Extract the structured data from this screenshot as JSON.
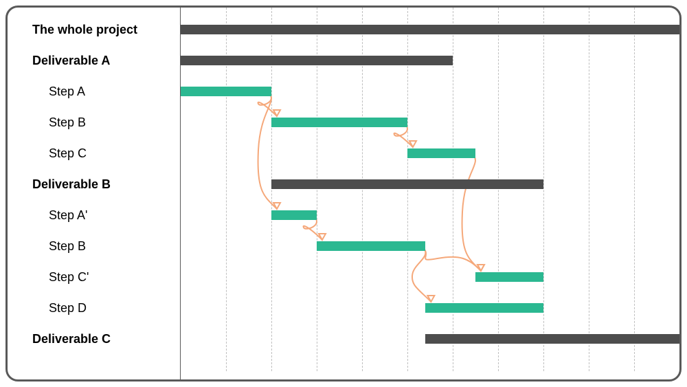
{
  "chart_data": {
    "type": "bar",
    "title": "",
    "xlabel": "",
    "ylabel": "",
    "x_range": [
      0,
      11
    ],
    "grid_lines": [
      1,
      2,
      3,
      4,
      5,
      6,
      7,
      8,
      9,
      10
    ],
    "rows": [
      {
        "id": "whole",
        "label": "The whole project",
        "kind": "summary",
        "start": 0,
        "end": 11
      },
      {
        "id": "delA",
        "label": "Deliverable A",
        "kind": "summary",
        "start": 0,
        "end": 6
      },
      {
        "id": "stepA",
        "label": "Step A",
        "kind": "task",
        "start": 0,
        "end": 2
      },
      {
        "id": "stepB",
        "label": "Step B",
        "kind": "task",
        "start": 2,
        "end": 5
      },
      {
        "id": "stepC",
        "label": "Step C",
        "kind": "task",
        "start": 5,
        "end": 6.5
      },
      {
        "id": "delB",
        "label": "Deliverable B",
        "kind": "summary",
        "start": 2,
        "end": 8
      },
      {
        "id": "stepAp",
        "label": "Step A'",
        "kind": "task",
        "start": 2,
        "end": 3
      },
      {
        "id": "stepB2",
        "label": "Step B",
        "kind": "task",
        "start": 3,
        "end": 5.4
      },
      {
        "id": "stepCp",
        "label": "Step C'",
        "kind": "task",
        "start": 6.5,
        "end": 8
      },
      {
        "id": "stepD",
        "label": "Step D",
        "kind": "task",
        "start": 5.4,
        "end": 8
      },
      {
        "id": "delC",
        "label": "Deliverable C",
        "kind": "summary",
        "start": 5.4,
        "end": 11
      }
    ],
    "dependencies": [
      {
        "from": "stepA",
        "to": "stepB"
      },
      {
        "from": "stepA",
        "to": "stepAp"
      },
      {
        "from": "stepB",
        "to": "stepC"
      },
      {
        "from": "stepC",
        "to": "stepCp"
      },
      {
        "from": "stepAp",
        "to": "stepB2"
      },
      {
        "from": "stepB2",
        "to": "stepCp"
      },
      {
        "from": "stepB2",
        "to": "stepD"
      }
    ],
    "colors": {
      "summary": "#4d4d4d",
      "task": "#2bb891",
      "dependency": "#f5a87a",
      "grid": "#bfbfbf",
      "frame": "#595959"
    }
  }
}
